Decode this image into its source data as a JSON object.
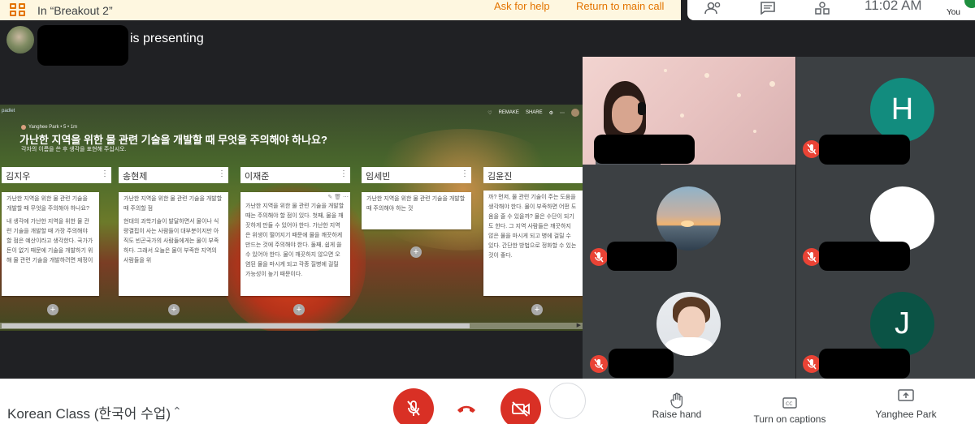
{
  "top_bar": {
    "breakout_label": "In “Breakout 2”",
    "ask_for_help": "Ask for help",
    "return_to_main": "Return to main call",
    "clock": "11:02 AM",
    "you_label": "You",
    "icons": [
      "people-icon",
      "chat-icon",
      "activities-icon"
    ]
  },
  "presenter": {
    "text": "is presenting"
  },
  "padlet": {
    "logo": "padlet",
    "tools": {
      "remake": "REMAKE",
      "share": "SHARE"
    },
    "author": "Yanghee Park • 5 • 1m",
    "title": "가난한 지역을 위한 물 관련 기술을 개발할 때 무엇을 주의해야 하나요?",
    "subtitle": "각자의 이름을 쓴 후 생각을 표현해 주십시오.",
    "columns": [
      {
        "header": "김지우",
        "card_title": "가난한 지역을 위한 물 관련 기술을 개발할 때 무엇을 주의해야 하나요?",
        "card_body": "내 생각에 가난한 지역을 위한 물 관련 기술을 개발할 때 가장 주의해야 할 점은 예산이라고 생각한다. 국가가 돈이 없기 때문에 기술을 개발하기 위해 물 관련 기술을 개발하려면 재정이"
      },
      {
        "header": "송현제",
        "card_title": "가난한 지역을 위한 물 관련 기술을 개발할 때 주의할 점",
        "card_body": "현대의 과학기술이 발달하면서 물이나 식량결핍이 사는 사람들이 대부분이지만 아직도 빈곤국가의 사람들에게는 물이 부족하다. 그래서 오늘은 물이 부족한 지역의 사람들을 위"
      },
      {
        "header": "이재준",
        "card_title": "",
        "card_body": "가난한 지역을 위한 물 관련 기술을 개발할 때는 주의해야 할 점이 있다. 첫째, 물을 깨끗하게 만들 수 있어야 한다. 가난한 지역은 위생이 떨어지기 때문에 물을 깨끗하게 만드는 것에 주의해야 한다. 둘째, 쉽게 쓸 수 있어야 한다. 물이 깨끗하지 않으면 오염된 물을 마시게 되고 각종 질병에 걸릴 가능성이 높기 때문이다."
      },
      {
        "header": "임세빈",
        "card_title": "",
        "card_body": "가난한 지역을 위한 물 관련 기술을 개발할 때 주의해야 하는 것"
      },
      {
        "header": "김윤진",
        "card_title": "",
        "card_body": "까? 먼저, 물 관련 기술이 주는 도움을 생각해야 한다. 물이 부족하면 어떤 도움을 줄 수 있을까? 물은 수단이 되기도 한다. 그 지역 사람들은 깨끗하지 않은 물을 마시게 되고 병에 걸릴 수 있다. 간단한 방법으로 정화할 수 있는 것이 좋다."
      }
    ],
    "add_label": "+"
  },
  "participants": {
    "h_initial": "H",
    "j_initial": "J"
  },
  "bottom_bar": {
    "meeting_name": "Korean Class (한국어 수업)",
    "raise_hand": "Raise hand",
    "captions": "Turn on captions",
    "presenting": "Yanghee Park"
  },
  "colors": {
    "breakout_bg": "#fef7e0",
    "accent_orange": "#e37400",
    "muted_red": "#ea4335",
    "control_red": "#d93025",
    "h_avatar": "#128c7e",
    "j_avatar": "#0b5345"
  }
}
